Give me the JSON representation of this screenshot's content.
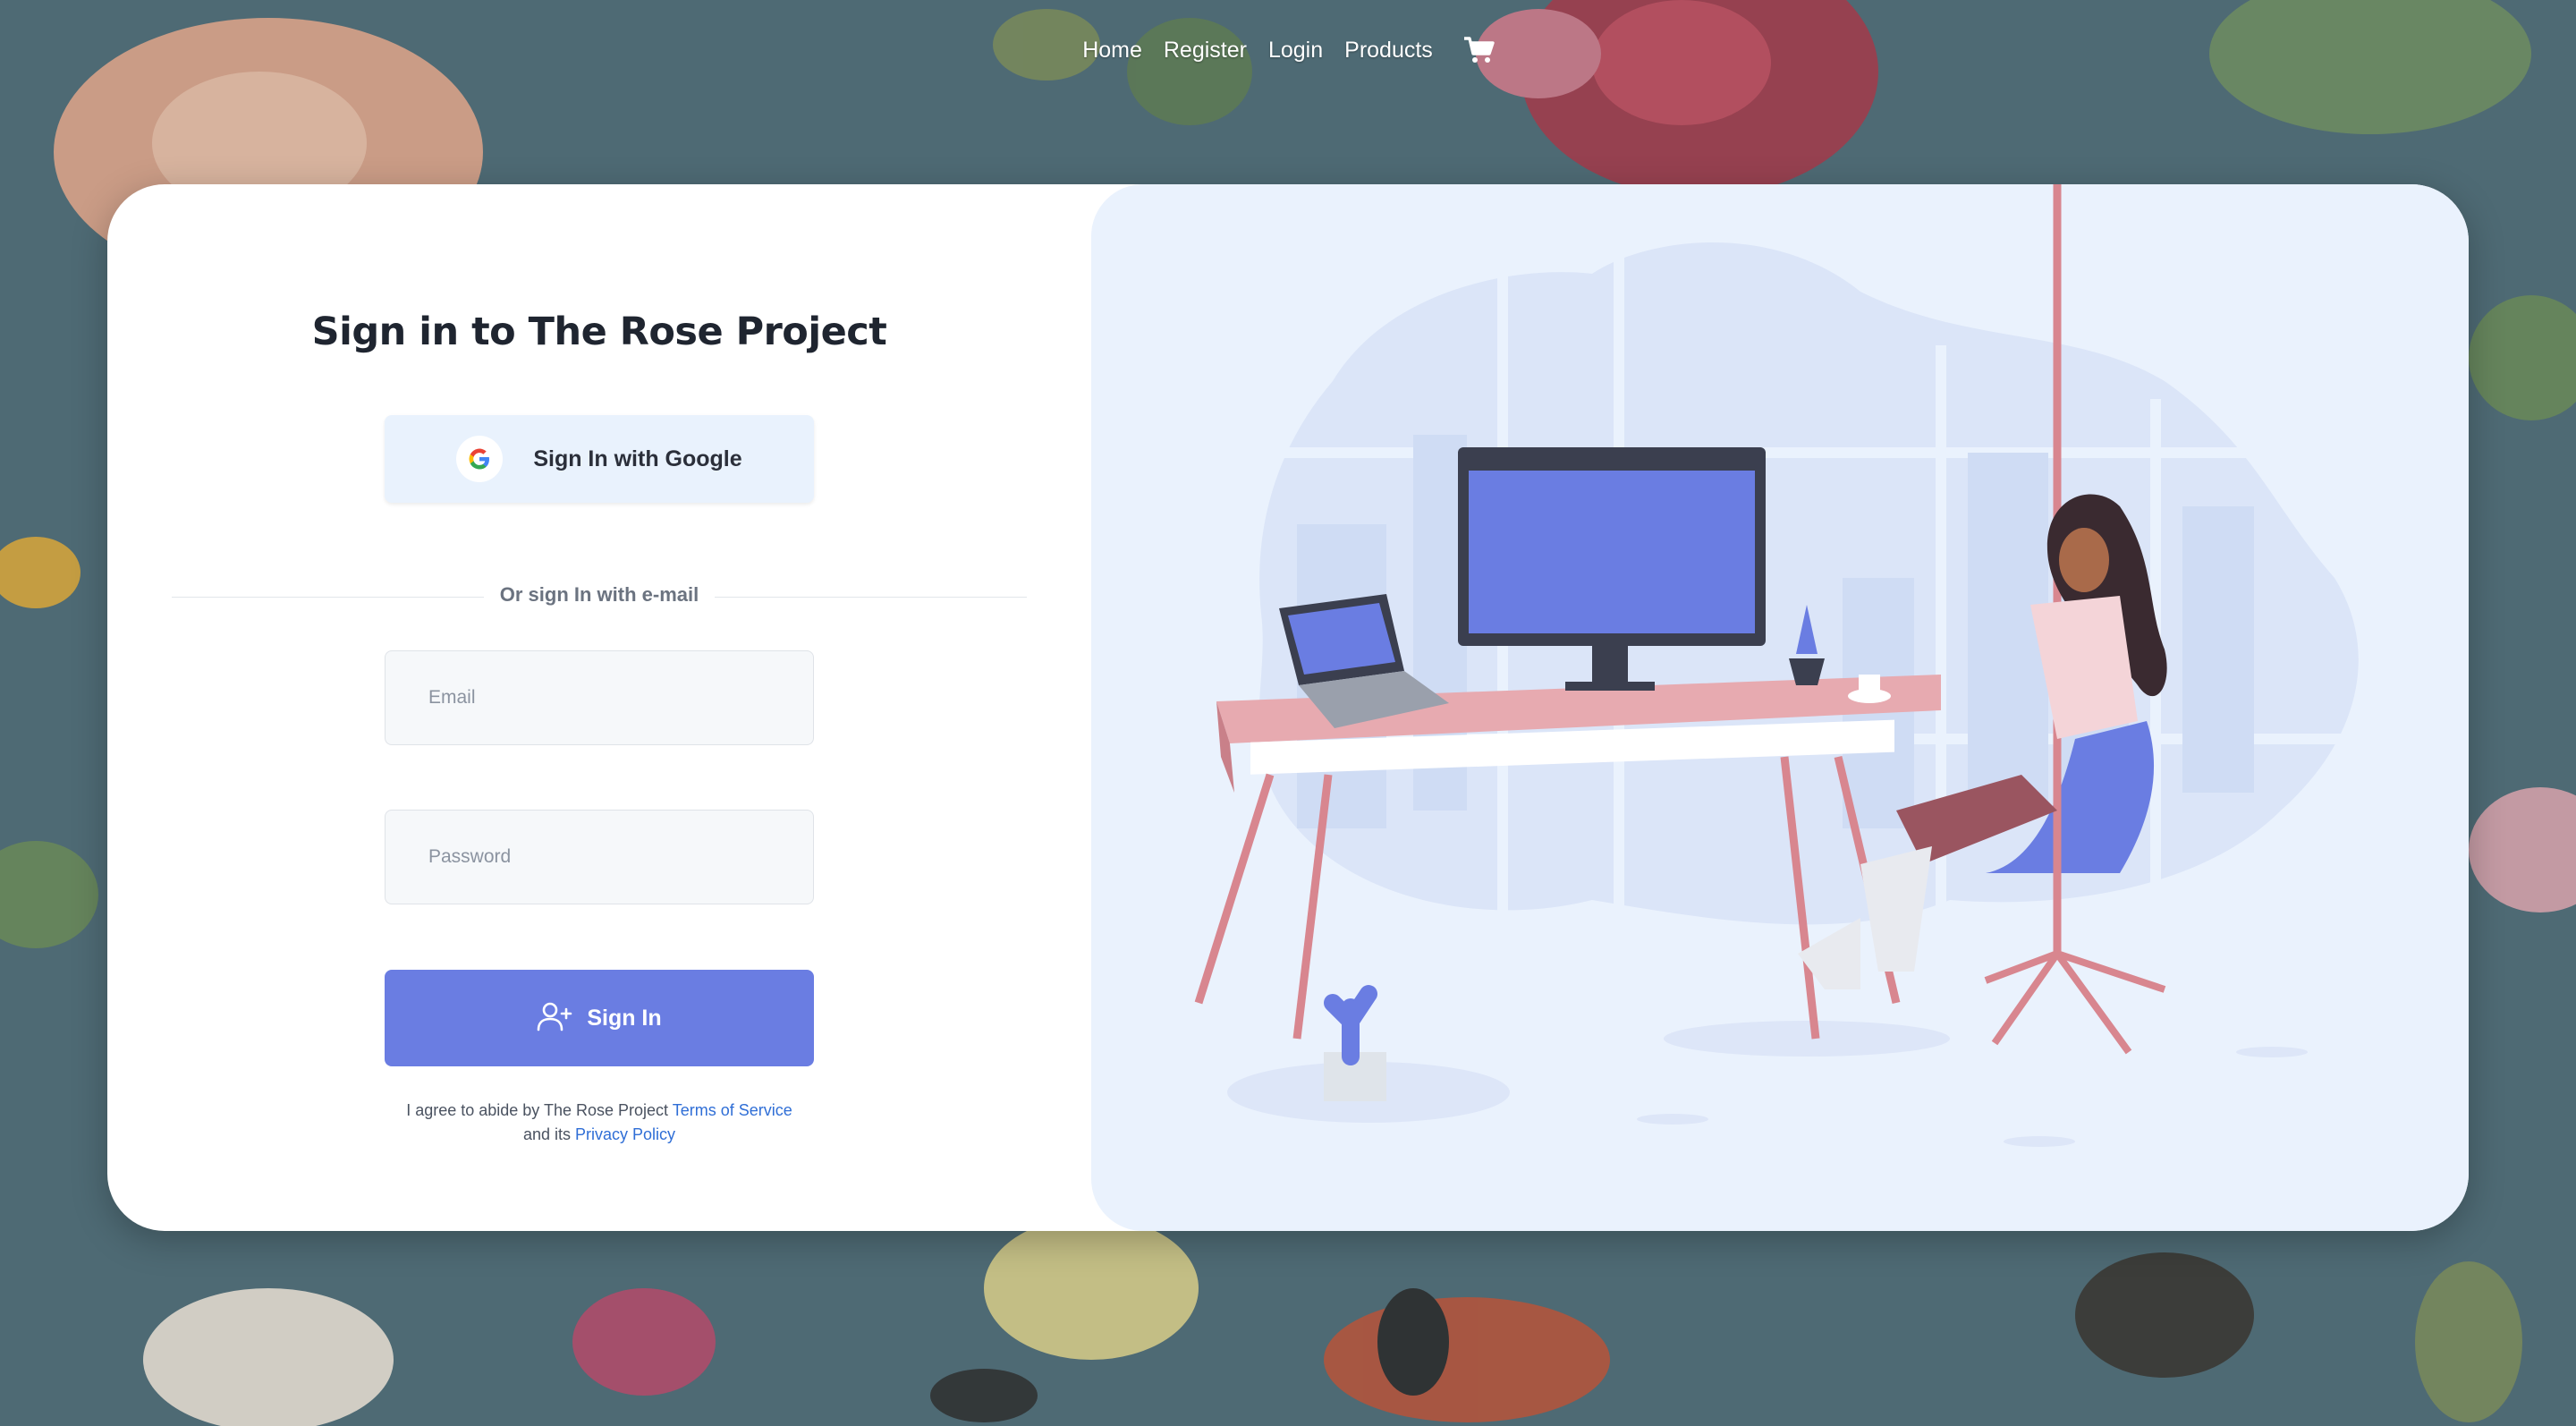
{
  "nav": {
    "links": [
      "Home",
      "Register",
      "Login",
      "Products"
    ],
    "cart_icon": "shopping-cart-icon"
  },
  "login": {
    "title": "Sign in to The Rose Project",
    "google_button": "Sign In with Google",
    "divider": "Or sign In with e-mail",
    "email_placeholder": "Email",
    "password_placeholder": "Password",
    "submit": "Sign In",
    "terms_prefix": "I agree to abide by The Rose Project",
    "terms_link": "Terms of Service",
    "terms_middle": "and its",
    "privacy_link": "Privacy Policy"
  },
  "illustration": {
    "description_icon": "workspace-illustration"
  },
  "colors": {
    "accent": "#6a7de2",
    "panel": "#eaf2fd",
    "link": "#2f6ed6"
  }
}
